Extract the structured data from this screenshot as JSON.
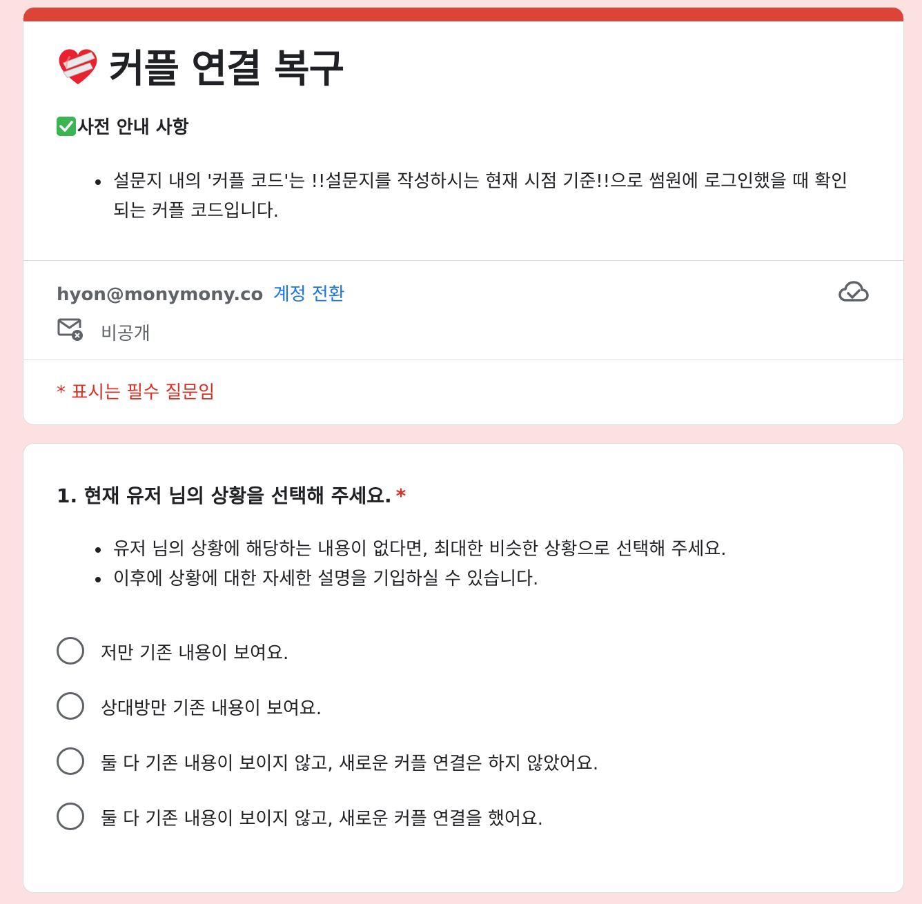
{
  "form": {
    "title": "커플 연결 복구",
    "title_emoji": "mending-heart-icon",
    "accent_color": "#db4437",
    "notice_heading": "사전 안내 사항",
    "notice_items": [
      "설문지 내의 '커플 코드'는 !!설문지를 작성하시는 현재 시점 기준!!으로 썸원에 로그인했을 때 확인되는 커플 코드입니다."
    ],
    "account_email": "hyon@monymony.co",
    "switch_account": "계정 전환",
    "privacy_label": "비공개",
    "required_note": "* 표시는 필수 질문임"
  },
  "question": {
    "title": "1. 현재 유저 님의 상황을 선택해 주세요.",
    "required_mark": "*",
    "help_items": [
      "유저 님의 상황에 해당하는 내용이 없다면, 최대한 비슷한 상황으로 선택해 주세요.",
      "이후에 상황에 대한 자세한 설명을 기입하실 수 있습니다."
    ],
    "options": [
      "저만 기존 내용이 보여요.",
      "상대방만 기존 내용이 보여요.",
      "둘 다 기존 내용이 보이지 않고, 새로운 커플 연결은 하지 않았어요.",
      "둘 다 기존 내용이 보이지 않고, 새로운 커플 연결을 했어요."
    ]
  },
  "colors": {
    "background": "#fbe2e1",
    "link": "#1a73e8",
    "required": "#d93025"
  }
}
